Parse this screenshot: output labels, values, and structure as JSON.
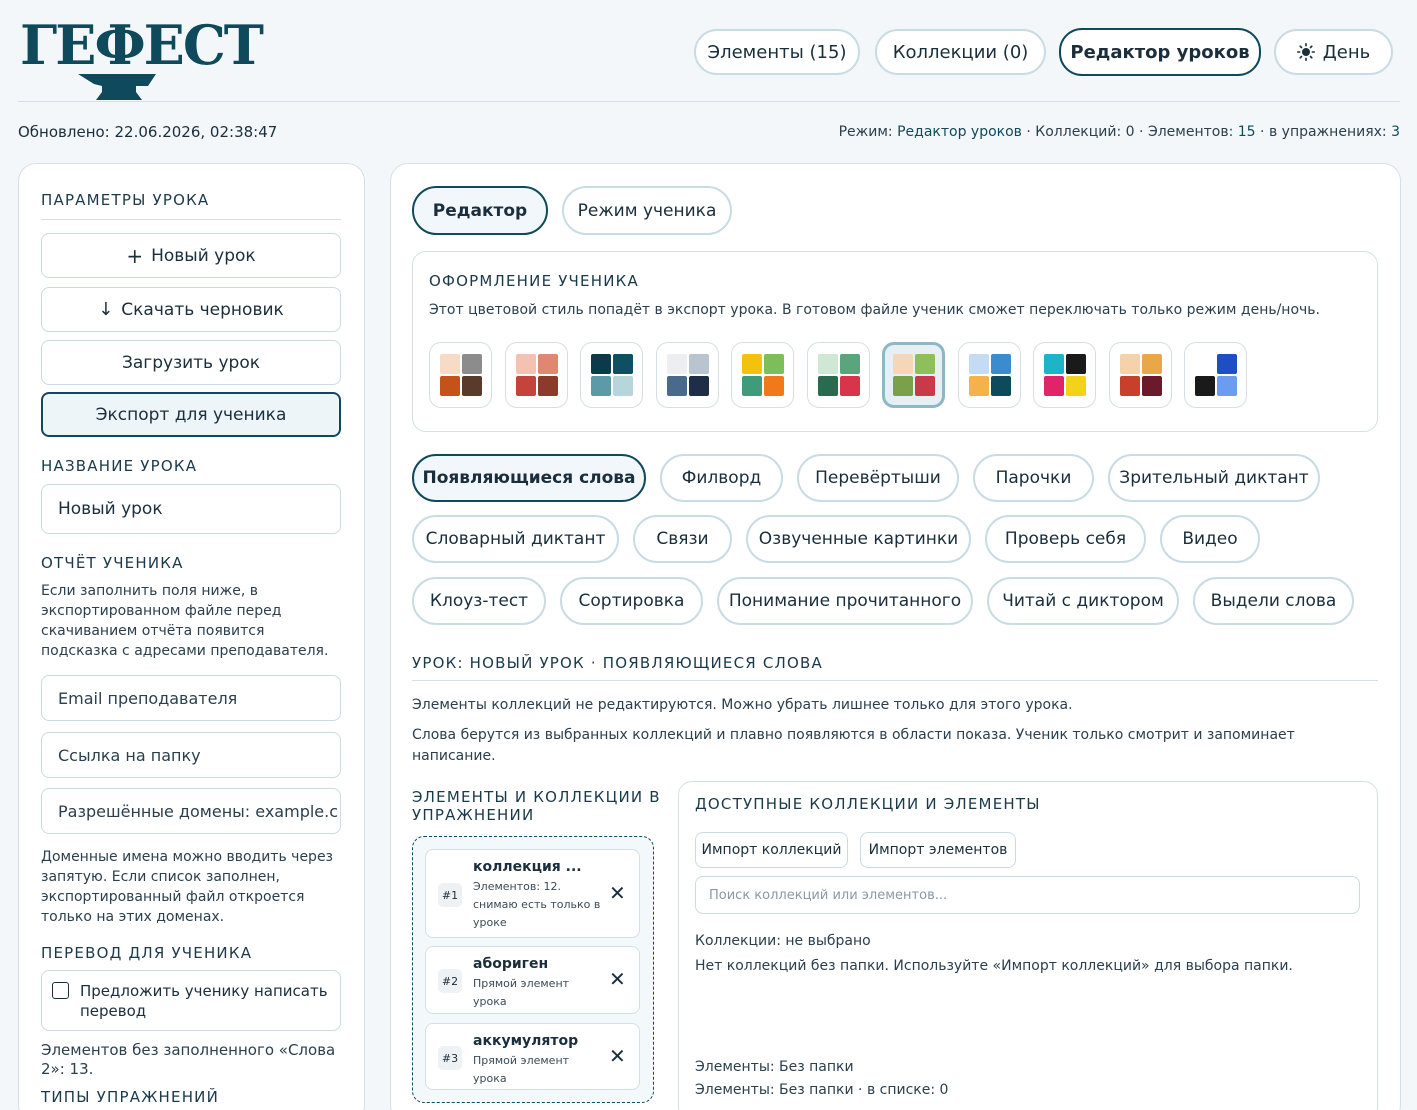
{
  "app": {
    "logo_text": "ГЕФЕСТ"
  },
  "nav": {
    "elements": "Элементы (15)",
    "collections": "Коллекции (0)",
    "lesson_editor": "Редактор уроков",
    "theme": "День"
  },
  "status": {
    "updated": "Обновлено: 22.06.2026, 02:38:47",
    "mode_label": "Режим:",
    "mode_value": "Редактор уроков",
    "collections_label": "Коллекций:",
    "collections_value": "0",
    "elements_label": "Элементов:",
    "elements_value": "15",
    "in_exercises_label": "в упражнениях:",
    "in_exercises_value": "3",
    "sep": "·"
  },
  "sidebar": {
    "params_title": "ПАРАМЕТРЫ УРОКА",
    "new_lesson": "Новый урок",
    "download_draft": "Скачать черновик",
    "load_lesson": "Загрузить урок",
    "export_student": "Экспорт для ученика",
    "name_title": "НАЗВАНИЕ УРОКА",
    "lesson_name": "Новый урок",
    "report_title": "ОТЧЁТ УЧЕНИКА",
    "report_hint": "Если заполнить поля ниже, в экспортированном файле перед скачиванием отчёта появится подсказка с адресами преподавателя.",
    "email_placeholder": "Email преподавателя",
    "folder_placeholder": "Ссылка на папку",
    "domains_placeholder": "Разрешённые домены: example.c",
    "domains_hint": "Доменные имена можно вводить через запятую. Если список заполнен, экспортированный файл откроется только на этих доменах.",
    "translation_title": "ПЕРЕВОД ДЛЯ УЧЕНИКА",
    "translation_checkbox": "Предложить ученику написать перевод",
    "translation_count": "Элементов без заполненного «Слова 2»: 13.",
    "types_title": "ТИПЫ УПРАЖНЕНИЙ"
  },
  "main": {
    "tab_editor": "Редактор",
    "tab_student": "Режим ученика",
    "style_title": "ОФОРМЛЕНИЕ УЧЕНИКА",
    "style_desc": "Этот цветовой стиль попадёт в экспорт урока. В готовом файле ученик сможет переключать только режим день/ночь.",
    "palettes": [
      [
        "#f6dcc4",
        "#8c8c8c",
        "#c4531a",
        "#5a3a2a"
      ],
      [
        "#f3c2b0",
        "#e08770",
        "#c4433a",
        "#8c3a2a"
      ],
      [
        "#0d3a4a",
        "#0e4f63",
        "#5b9aa6",
        "#b6d6dc"
      ],
      [
        "#eceef1",
        "#b8c4d0",
        "#4a6a8c",
        "#1e2e46"
      ],
      [
        "#f3c20e",
        "#7cbf5a",
        "#3e9c7a",
        "#f07a1a"
      ],
      [
        "#cfe8d4",
        "#5aa57c",
        "#2a6a4e",
        "#d8344a"
      ],
      [
        "#f6d6b8",
        "#8fbf5a",
        "#7aa04a",
        "#c83a4a"
      ],
      [
        "#c4dcf3",
        "#3a8ccf",
        "#f3b24a",
        "#0d4a5c"
      ],
      [
        "#1eb4c8",
        "#1a1a1a",
        "#e0246a",
        "#f3d21a"
      ],
      [
        "#f6d2aa",
        "#e8a84a",
        "#c8402a",
        "#6a1a2a"
      ],
      [
        "#ffffff",
        "#1e4ec4",
        "#1a1a1a",
        "#6a9cf0"
      ]
    ],
    "selected_palette": 6,
    "exercise_types": [
      "Появляющиеся слова",
      "Филворд",
      "Перевёртыши",
      "Парочки",
      "Зрительный диктант",
      "Словарный диктант",
      "Связи",
      "Озвученные картинки",
      "Проверь себя",
      "Видео",
      "Клоуз-тест",
      "Сортировка",
      "Понимание прочитанного",
      "Читай с диктором",
      "Выдели слова"
    ],
    "lesson_header": "УРОК: НОВЫЙ УРОК · ПОЯВЛЯЮЩИЕСЯ СЛОВА",
    "note1": "Элементы коллекций не редактируются. Можно убрать лишнее только для этого урока.",
    "note2": "Слова берутся из выбранных коллекций и плавно появляются в области показа. Ученик только смотрит и запоминает написание.",
    "in_exercise_title": "ЭЛЕМЕНТЫ И КОЛЛЕКЦИИ В УПРАЖНЕНИИ",
    "items": [
      {
        "num": "#1",
        "title": "коллекция ...",
        "sub": "Элементов: 12. снимаю есть только в уроке"
      },
      {
        "num": "#2",
        "title": "абориген",
        "sub": "Прямой элемент урока"
      },
      {
        "num": "#3",
        "title": "аккумулятор",
        "sub": "Прямой элемент урока"
      }
    ],
    "available_title": "ДОСТУПНЫЕ КОЛЛЕКЦИИ И ЭЛЕМЕНТЫ",
    "import_collections": "Импорт коллекций",
    "import_elements": "Импорт элементов",
    "search_placeholder": "Поиск коллекций или элементов...",
    "collections_status": "Коллекции: не выбрано",
    "no_collections": "Нет коллекций без папки. Используйте «Импорт коллекций» для выбора папки.",
    "elements_folder": "Элементы: Без папки",
    "elements_folder_count": "Элементы: Без папки · в списке: 0"
  }
}
